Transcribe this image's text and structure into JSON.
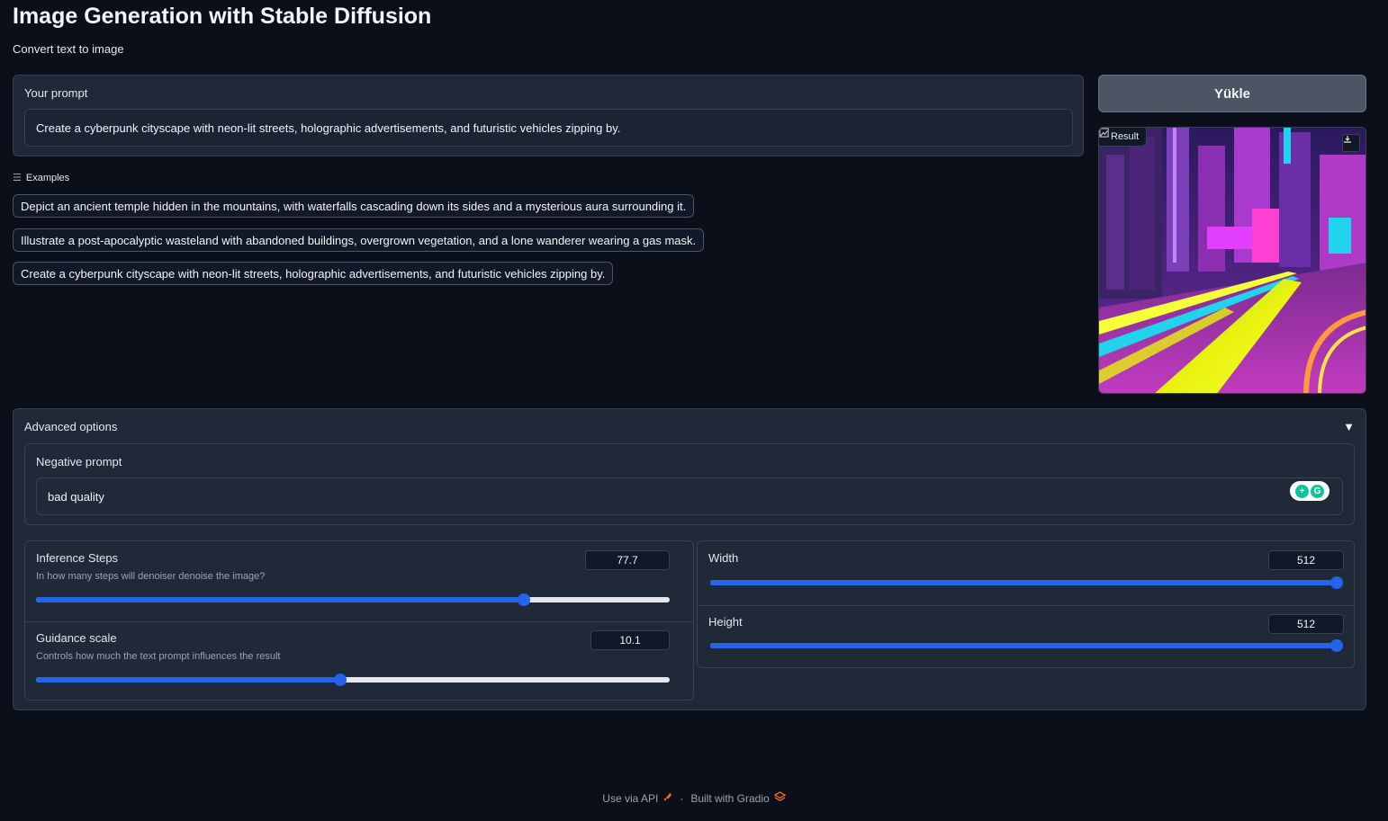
{
  "header": {
    "title": "Image Generation with Stable Diffusion",
    "subtitle": "Convert text to image"
  },
  "prompt": {
    "label": "Your prompt",
    "value": "Create a cyberpunk cityscape with neon-lit streets, holographic advertisements, and futuristic vehicles zipping by."
  },
  "examples": {
    "header": "Examples",
    "items": [
      "Depict an ancient temple hidden in the mountains, with waterfalls cascading down its sides and a mysterious aura surrounding it.",
      "Illustrate a post-apocalyptic wasteland with abandoned buildings, overgrown vegetation, and a lone wanderer wearing a gas mask.",
      "Create a cyberpunk cityscape with neon-lit streets, holographic advertisements, and futuristic vehicles zipping by."
    ]
  },
  "generate_button": {
    "label": "Yükle"
  },
  "result": {
    "label": "Result",
    "icon": "image-icon",
    "download_icon": "download-icon"
  },
  "advanced": {
    "title": "Advanced options",
    "toggle_icon": "triangle-down-icon",
    "negative_prompt": {
      "label": "Negative prompt",
      "value": "bad quality"
    },
    "sliders": {
      "steps": {
        "label": "Inference Steps",
        "info": "In how many steps will denoiser denoise the image?",
        "value": "77.7",
        "fraction": 0.77
      },
      "guidance": {
        "label": "Guidance scale",
        "info": "Controls how much the text prompt influences the result",
        "value": "10.1",
        "fraction": 0.48
      },
      "width": {
        "label": "Width",
        "value": "512",
        "fraction": 1.0
      },
      "height": {
        "label": "Height",
        "value": "512",
        "fraction": 1.0
      }
    }
  },
  "footer": {
    "api_label": "Use via API",
    "separator": "·",
    "built_label": "Built with Gradio"
  },
  "colors": {
    "background": "#0b0f19",
    "panel": "#1f2937",
    "accent": "#2563eb",
    "button": "#4b5563"
  }
}
